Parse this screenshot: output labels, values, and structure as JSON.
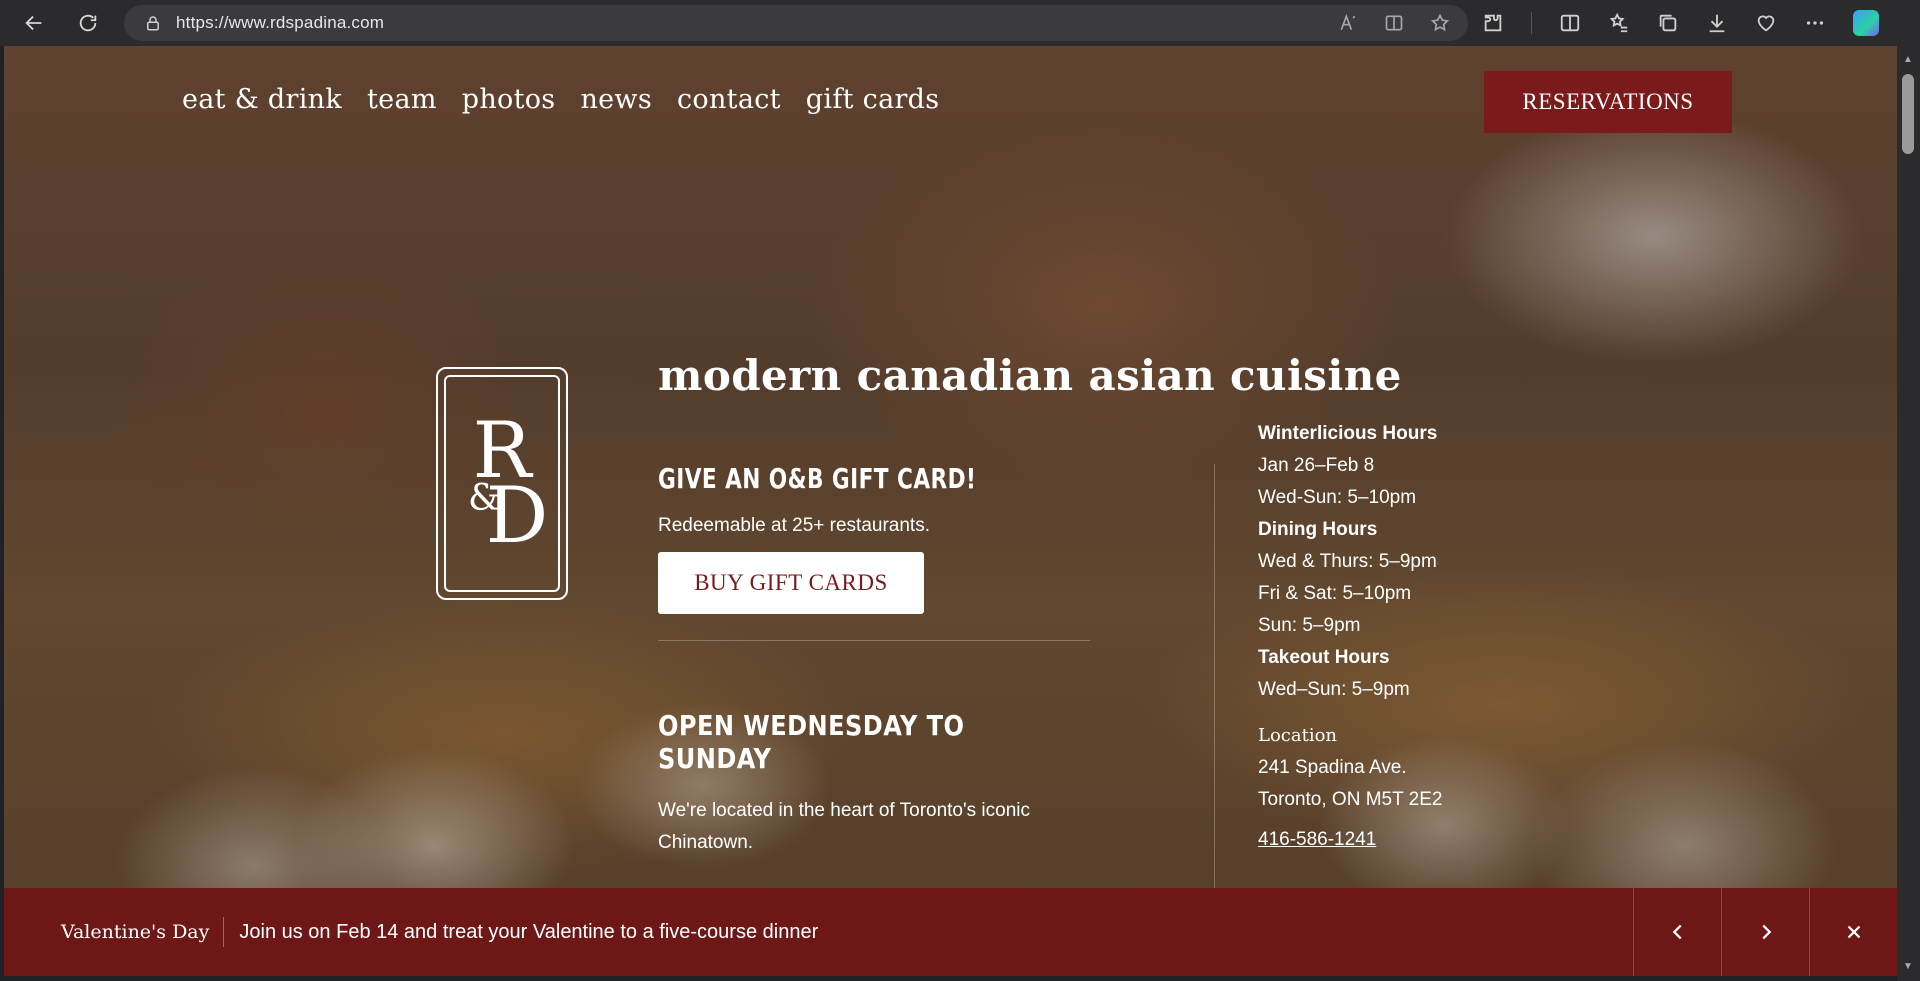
{
  "browser": {
    "url": "https://www.rdspadina.com",
    "icons": [
      "back-icon",
      "refresh-icon",
      "lock-icon",
      "read-aloud-icon",
      "immersive-reader-icon",
      "favorite-star-icon",
      "extensions-icon",
      "split-screen-icon",
      "favorites-icon",
      "collections-icon",
      "downloads-icon",
      "health-icon",
      "more-icon",
      "copilot-icon"
    ]
  },
  "nav": {
    "items": [
      "eat & drink",
      "team",
      "photos",
      "news",
      "contact",
      "gift cards"
    ],
    "reservations": "RESERVATIONS"
  },
  "hero": {
    "tagline": "modern canadian asian cuisine",
    "logo_text": {
      "r": "R",
      "amp": "&",
      "d": "D"
    },
    "promo_title": "GIVE AN O&B GIFT CARD!",
    "promo_sub": "Redeemable at 25+ restaurants.",
    "gift_button": "BUY GIFT CARDS",
    "open_title": "OPEN WEDNESDAY TO SUNDAY",
    "open_sub": "We're located in the heart of Toronto's iconic Chinatown."
  },
  "hours": {
    "winterlicious_title": "Winterlicious Hours",
    "winterlicious_dates": "Jan 26–Feb 8",
    "winterlicious_times": "Wed-Sun: 5–10pm",
    "dining_title": "Dining Hours",
    "dining_1": "Wed & Thurs: 5–9pm",
    "dining_2": "Fri & Sat: 5–10pm",
    "dining_3": "Sun: 5–9pm",
    "takeout_title": "Takeout Hours",
    "takeout_1": "Wed–Sun: 5–9pm"
  },
  "location": {
    "heading": "Location",
    "address_1": "241 Spadina Ave.",
    "address_2": "Toronto, ON M5T 2E2",
    "phone": "416-586-1241"
  },
  "banner": {
    "label": "Valentine's Day",
    "text": "Join us on Feb 14 and treat your Valentine to a five-course dinner"
  },
  "colors": {
    "brand_red": "#7a1a1a",
    "banner_red": "#6e1717"
  }
}
